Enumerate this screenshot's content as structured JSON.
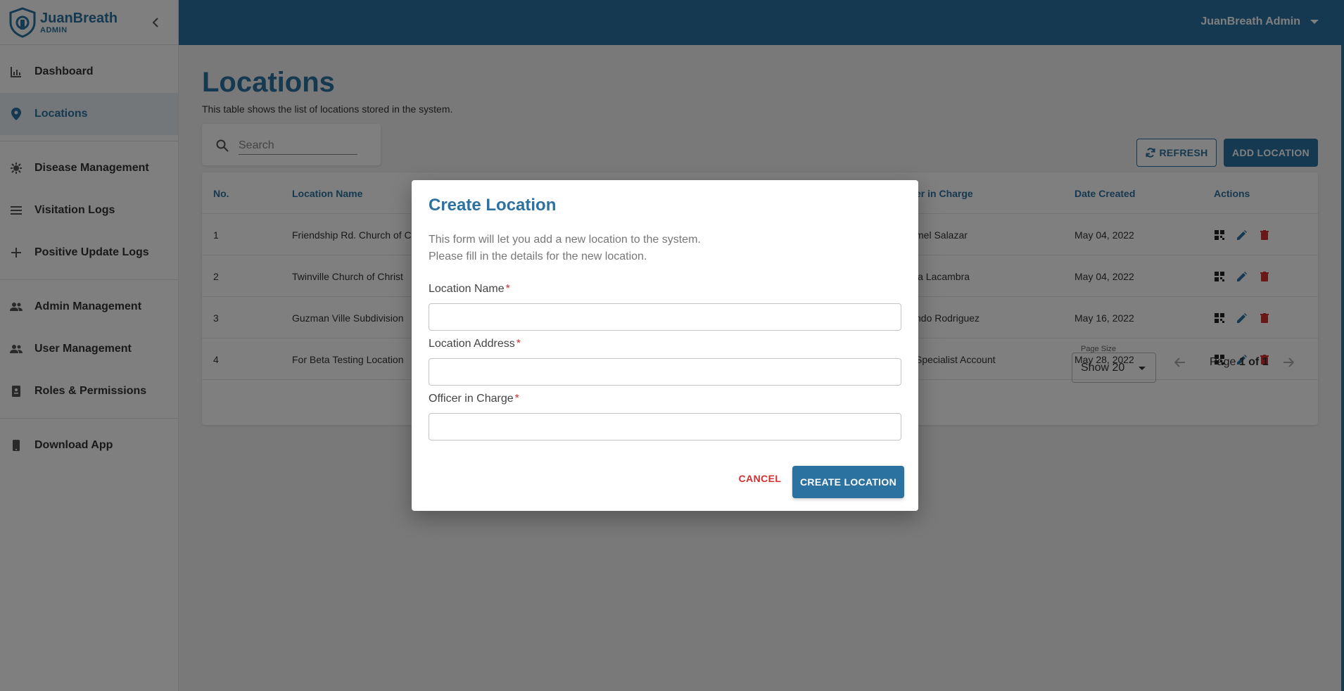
{
  "brand": {
    "name": "JuanBreath",
    "sub": "ADMIN"
  },
  "sidebar": {
    "items": [
      {
        "label": "Dashboard",
        "icon": "bar-chart-icon"
      },
      {
        "label": "Locations",
        "icon": "location-pin-icon"
      },
      {
        "label": "Disease Management",
        "icon": "virus-icon"
      },
      {
        "label": "Visitation Logs",
        "icon": "list-icon"
      },
      {
        "label": "Positive Update Logs",
        "icon": "plus-icon"
      },
      {
        "label": "Admin Management",
        "icon": "people-icon"
      },
      {
        "label": "User Management",
        "icon": "people-icon"
      },
      {
        "label": "Roles & Permissions",
        "icon": "badge-icon"
      },
      {
        "label": "Download App",
        "icon": "phone-icon"
      }
    ]
  },
  "header": {
    "user": "JuanBreath Admin"
  },
  "main": {
    "title": "Locations",
    "subtitle": "This table shows the list of locations stored in the system.",
    "search_placeholder": "Search",
    "refresh_label": "REFRESH",
    "add_label": "ADD LOCATION",
    "columns": [
      "No.",
      "Location Name",
      "er in Charge",
      "Date Created",
      "Actions"
    ],
    "rows": [
      {
        "no": "1",
        "name": "Friendship Rd. Church of C",
        "officer": "mel Salazar",
        "date": "May 04, 2022"
      },
      {
        "no": "2",
        "name": "Twinville Church of Christ",
        "officer": "ia Lacambra",
        "date": "May 04, 2022"
      },
      {
        "no": "3",
        "name": "Guzman Ville Subdivision",
        "officer": "ndo Rodriguez",
        "date": "May 16, 2022"
      },
      {
        "no": "4",
        "name": "For Beta Testing Location",
        "officer": "Specialist Account",
        "date": "May 28, 2022"
      }
    ],
    "page_size_label": "Page Size",
    "page_size_value": "Show 20",
    "page_prefix": "Page ",
    "page_current": "1 of 1"
  },
  "dialog": {
    "title": "Create Location",
    "desc_line1": "This form will let you add a new location to the system.",
    "desc_line2": "Please fill in the details for the new location.",
    "fields": [
      {
        "label": "Location Name",
        "value": ""
      },
      {
        "label": "Location Address",
        "value": ""
      },
      {
        "label": "Officer in Charge",
        "value": ""
      }
    ],
    "required_mark": "*",
    "cancel_label": "CANCEL",
    "create_label": "CREATE LOCATION"
  },
  "colors": {
    "primary": "#2b72a0",
    "danger": "#d32f2f",
    "qr": "#222222"
  }
}
